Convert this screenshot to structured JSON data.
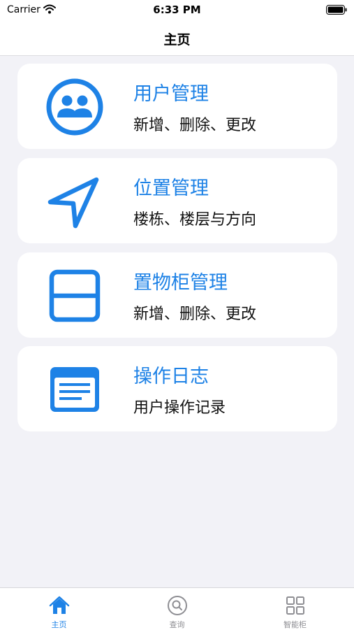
{
  "status_bar": {
    "carrier": "Carrier",
    "time": "6:33 PM"
  },
  "navbar": {
    "title": "主页"
  },
  "colors": {
    "accent": "#1e82e6",
    "background": "#f2f2f7",
    "card": "#ffffff",
    "tab_inactive": "#8e8e93"
  },
  "menu": [
    {
      "title": "用户管理",
      "subtitle": "新增、删除、更改",
      "icon": "users-icon"
    },
    {
      "title": "位置管理",
      "subtitle": "楼栋、楼层与方向",
      "icon": "location-arrow-icon"
    },
    {
      "title": "置物柜管理",
      "subtitle": "新增、删除、更改",
      "icon": "cabinet-icon"
    },
    {
      "title": "操作日志",
      "subtitle": "用户操作记录",
      "icon": "log-document-icon"
    }
  ],
  "tabs": [
    {
      "label": "主页",
      "icon": "home-icon",
      "selected": true
    },
    {
      "label": "查询",
      "icon": "search-icon",
      "selected": false
    },
    {
      "label": "智能柜",
      "icon": "grid-icon",
      "selected": false
    }
  ]
}
